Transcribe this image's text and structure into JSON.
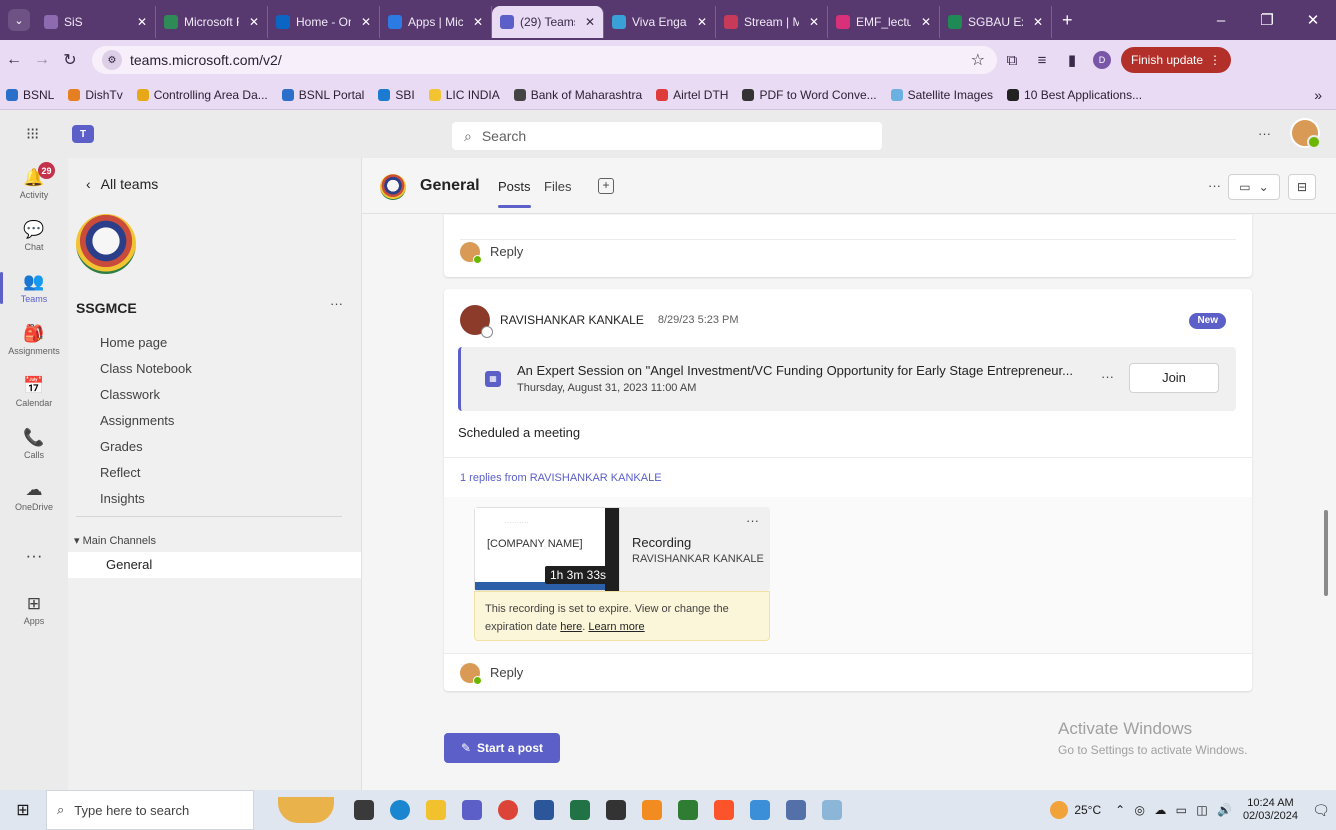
{
  "browser": {
    "tabs": [
      {
        "label": "SiS",
        "color": "#8e6bb0"
      },
      {
        "label": "Microsoft F",
        "color": "#2e8b57"
      },
      {
        "label": "Home - On",
        "color": "#0a66c2"
      },
      {
        "label": "Apps | Micr",
        "color": "#2c7be5"
      },
      {
        "label": "(29) Teams",
        "color": "#5b5fc7",
        "active": true
      },
      {
        "label": "Viva Engag",
        "color": "#3aa0d8"
      },
      {
        "label": "Stream | M",
        "color": "#c83a5a"
      },
      {
        "label": "EMF_lectur",
        "color": "#d9307a"
      },
      {
        "label": "SGBAU Exa",
        "color": "#1f8a55"
      }
    ],
    "new_tab": "+",
    "url": "teams.microsoft.com/v2/",
    "profile_initial": "D",
    "finish_update": "Finish update",
    "bookmarks": [
      {
        "label": "BSNL",
        "color": "#2a6fc9"
      },
      {
        "label": "DishTv",
        "color": "#e67e22"
      },
      {
        "label": "Controlling Area Da...",
        "color": "#e6a817"
      },
      {
        "label": "BSNL Portal",
        "color": "#2a6fc9"
      },
      {
        "label": "SBI",
        "color": "#1a7bd0"
      },
      {
        "label": "LIC INDIA",
        "color": "#f2c431"
      },
      {
        "label": "Bank of Maharashtra",
        "color": "#444444"
      },
      {
        "label": "Airtel DTH",
        "color": "#e03b3b"
      },
      {
        "label": "PDF to Word Conve...",
        "color": "#333333"
      },
      {
        "label": "Satellite Images",
        "color": "#6ab0e0"
      },
      {
        "label": "10 Best Applications...",
        "color": "#222222"
      }
    ]
  },
  "teams": {
    "search_placeholder": "Search",
    "rail": [
      {
        "label": "Activity",
        "icon": "bell-icon",
        "glyph": "🔔",
        "badge": "29"
      },
      {
        "label": "Chat",
        "icon": "chat-icon",
        "glyph": "💬"
      },
      {
        "label": "Teams",
        "icon": "teams-icon",
        "glyph": "👥",
        "active": true
      },
      {
        "label": "Assignments",
        "icon": "assignments-icon",
        "glyph": "🎒"
      },
      {
        "label": "Calendar",
        "icon": "calendar-icon",
        "glyph": "📅"
      },
      {
        "label": "Calls",
        "icon": "phone-icon",
        "glyph": "📞"
      },
      {
        "label": "OneDrive",
        "icon": "cloud-icon",
        "glyph": "☁"
      },
      {
        "label": "",
        "icon": "more-icon",
        "glyph": "···"
      },
      {
        "label": "Apps",
        "icon": "apps-icon",
        "glyph": "⊞"
      }
    ],
    "panel": {
      "back_label": "All teams",
      "team_name": "SSGMCE",
      "nav": [
        "Home page",
        "Class Notebook",
        "Classwork",
        "Assignments",
        "Grades",
        "Reflect",
        "Insights"
      ],
      "section": "Main Channels",
      "channel": "General"
    },
    "channel": {
      "name": "General",
      "tabs": [
        "Posts",
        "Files"
      ]
    },
    "reply_label": "Reply",
    "post": {
      "author": "RAVISHANKAR KANKALE",
      "time": "8/29/23 5:23 PM",
      "badge": "New",
      "meeting_title": "An Expert Session on \"Angel Investment/VC Funding Opportunity for Early Stage Entrepreneur...",
      "meeting_date": "Thursday, August 31, 2023 11:00 AM",
      "join_label": "Join",
      "text": "Scheduled a meeting",
      "replies_summary": "1 replies from RAVISHANKAR KANKALE",
      "recording": {
        "thumb_text": "[COMPANY NAME]",
        "duration": "1h 3m 33s",
        "title": "Recording",
        "by": "RAVISHANKAR KANKALE",
        "expire_text": "This recording is set to expire. View or change the expiration date",
        "here": "here",
        "learn_more": "Learn more"
      }
    },
    "start_post": "Start a post",
    "watermark": {
      "title": "Activate Windows",
      "sub": "Go to Settings to activate Windows."
    }
  },
  "taskbar": {
    "search_placeholder": "Type here to search",
    "apps": [
      {
        "name": "task-view-icon",
        "color": "#3a3a3a"
      },
      {
        "name": "edge-icon",
        "color": "#1a86d0"
      },
      {
        "name": "file-explorer-icon",
        "color": "#f2c12e"
      },
      {
        "name": "teams-taskbar-icon",
        "color": "#5b5fc7"
      },
      {
        "name": "chrome-icon",
        "color": "#db4437"
      },
      {
        "name": "word-icon",
        "color": "#2b579a"
      },
      {
        "name": "excel-icon",
        "color": "#217346"
      },
      {
        "name": "terminal-icon",
        "color": "#333333"
      },
      {
        "name": "sublime-icon",
        "color": "#f28b20"
      },
      {
        "name": "app-icon",
        "color": "#2e7d32"
      },
      {
        "name": "brave-icon",
        "color": "#fb542b"
      },
      {
        "name": "remote-desktop-icon",
        "color": "#3b8fd8"
      },
      {
        "name": "pen-icon",
        "color": "#5470a8"
      },
      {
        "name": "paint-icon",
        "color": "#8cb6d8"
      }
    ],
    "weather": "25°C",
    "time": "10:24 AM",
    "date": "02/03/2024"
  }
}
